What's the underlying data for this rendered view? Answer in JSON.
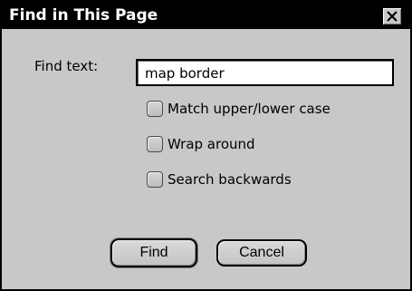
{
  "dialog": {
    "title": "Find in This Page",
    "close_icon": "close-icon"
  },
  "find": {
    "label": "Find text:",
    "value": "map border"
  },
  "options": [
    {
      "label": "Match upper/lower case",
      "checked": false
    },
    {
      "label": "Wrap around",
      "checked": false
    },
    {
      "label": "Search backwards",
      "checked": false
    }
  ],
  "buttons": {
    "find_label": "Find",
    "cancel_label": "Cancel"
  },
  "colors": {
    "titlebar": "#000000",
    "dialog_background": "#c8c8c8",
    "field_background": "#ffffff"
  }
}
